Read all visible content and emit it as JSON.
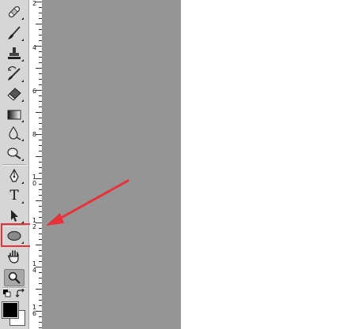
{
  "toolbar": {
    "tools": [
      {
        "name": "healing-brush-tool",
        "icon": "bandage-icon"
      },
      {
        "name": "brush-tool",
        "icon": "brush-icon"
      },
      {
        "name": "clone-stamp-tool",
        "icon": "stamp-icon"
      },
      {
        "name": "history-brush-tool",
        "icon": "history-brush-icon"
      },
      {
        "name": "eraser-tool",
        "icon": "eraser-icon"
      },
      {
        "name": "gradient-tool",
        "icon": "gradient-icon"
      },
      {
        "name": "blur-tool",
        "icon": "drop-icon"
      },
      {
        "name": "dodge-tool",
        "icon": "dodge-icon"
      },
      {
        "name": "pen-tool",
        "icon": "pen-icon"
      },
      {
        "name": "type-tool",
        "icon": "type-icon",
        "label": "T"
      },
      {
        "name": "path-selection-tool",
        "icon": "arrow-cursor-icon"
      },
      {
        "name": "ellipse-tool",
        "icon": "ellipse-icon",
        "highlighted": true
      },
      {
        "name": "hand-tool",
        "icon": "hand-icon"
      },
      {
        "name": "zoom-tool",
        "icon": "magnifier-icon",
        "active": true
      }
    ],
    "foreground_color": "#000000",
    "background_color": "#ffffff"
  },
  "ruler": {
    "labels": [
      "2",
      "4",
      "6",
      "8",
      "1\n0",
      "1\n2",
      "1\n4",
      "1\n6"
    ]
  },
  "colors": {
    "canvas": "#959595",
    "highlight": "#e8323a",
    "arrow": "#e8323a"
  }
}
